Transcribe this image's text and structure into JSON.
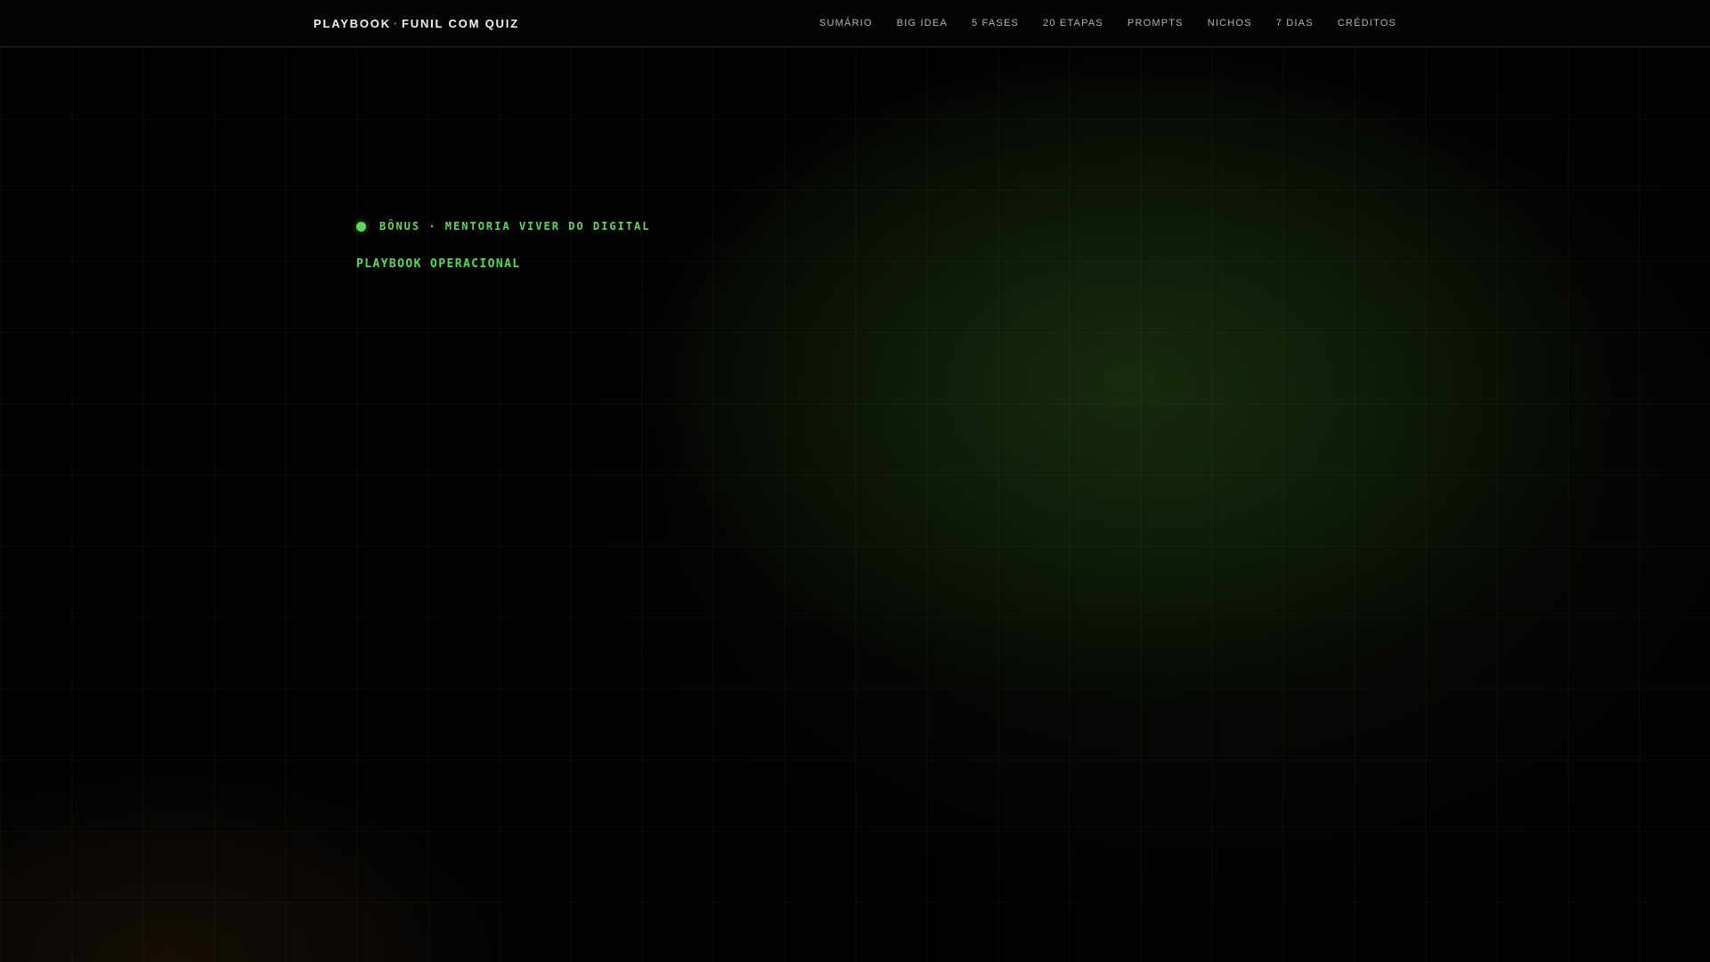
{
  "header": {
    "logo": {
      "part1": "PLAYBOOK",
      "separator": "·",
      "part2": "FUNIL COM QUIZ"
    },
    "nav": [
      {
        "label": "SUMÁRIO"
      },
      {
        "label": "BIG IDEA"
      },
      {
        "label": "5 FASES"
      },
      {
        "label": "20 ETAPAS"
      },
      {
        "label": "PROMPTS"
      },
      {
        "label": "NICHOS"
      },
      {
        "label": "7 DIAS"
      },
      {
        "label": "CRÉDITOS"
      }
    ]
  },
  "hero": {
    "eyebrow": "BÔNUS · MENTORIA VIVER DO DIGITAL",
    "title": "PLAYBOOK OPERACIONAL"
  },
  "colors": {
    "accent_green": "#63d363",
    "title_green": "#5cd95c",
    "nav_gray": "#b4b4b4",
    "logo_white": "#f2f2f2",
    "header_border": "#1f1f1f",
    "background": "#020202"
  }
}
